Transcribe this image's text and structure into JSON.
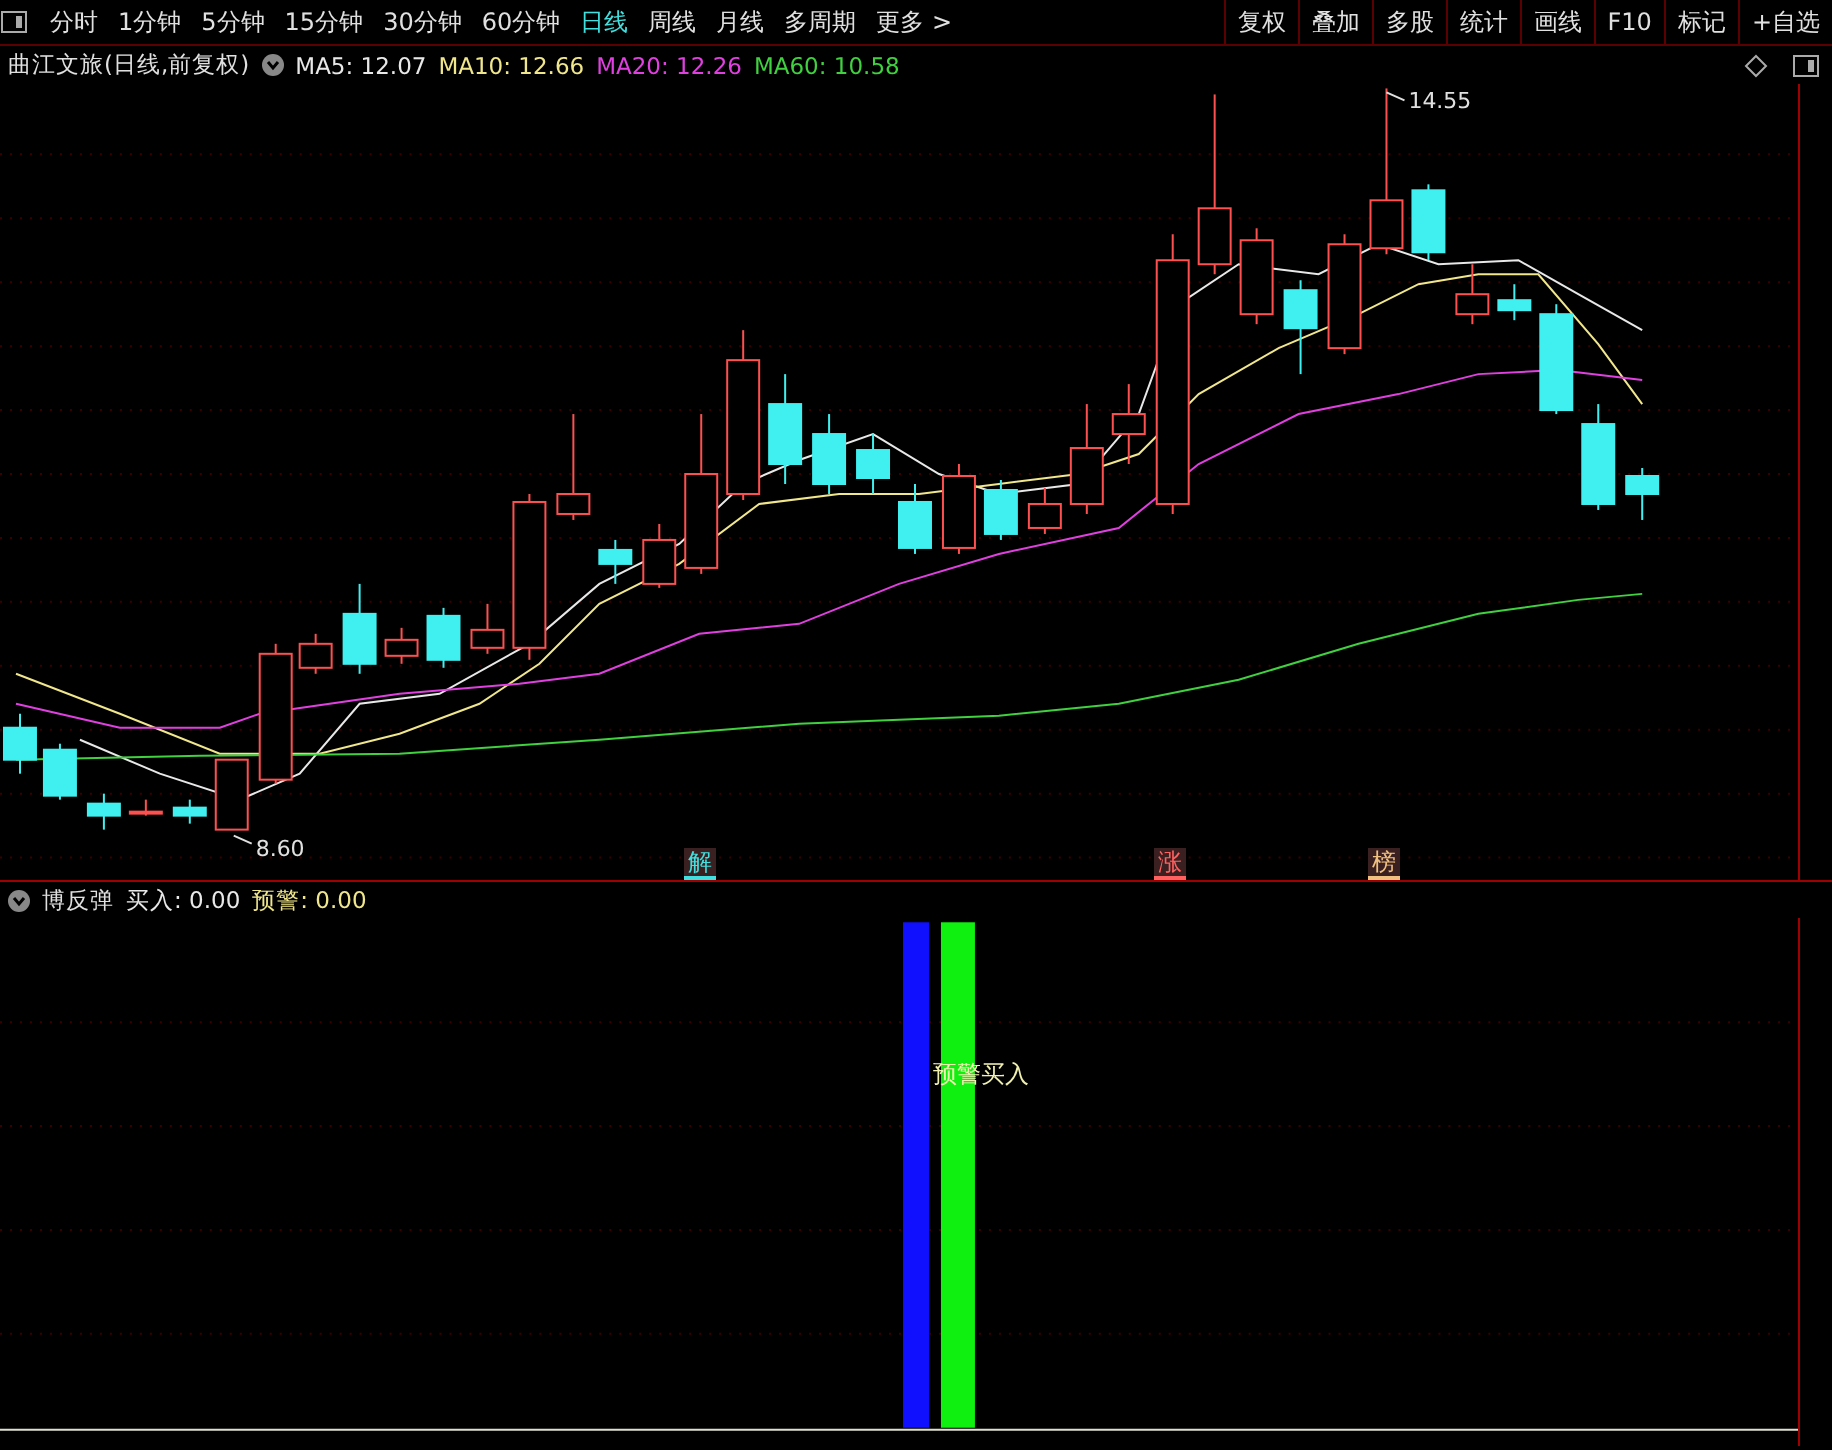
{
  "toolbar": {
    "periods": [
      {
        "label": "分时",
        "selected": false
      },
      {
        "label": "1分钟",
        "selected": false
      },
      {
        "label": "5分钟",
        "selected": false
      },
      {
        "label": "15分钟",
        "selected": false
      },
      {
        "label": "30分钟",
        "selected": false
      },
      {
        "label": "60分钟",
        "selected": false
      },
      {
        "label": "日线",
        "selected": true
      },
      {
        "label": "周线",
        "selected": false
      },
      {
        "label": "月线",
        "selected": false
      },
      {
        "label": "多周期",
        "selected": false
      }
    ],
    "more": "更多 >",
    "actions": [
      "复权",
      "叠加",
      "多股",
      "统计",
      "画线",
      "F10",
      "标记",
      "+自选"
    ]
  },
  "legend": {
    "title": "曲江文旅(日线,前复权)",
    "averages": [
      {
        "label": "MA5: 12.07",
        "color": "#e8e8e8"
      },
      {
        "label": "MA10: 12.66",
        "color": "#f0e68c"
      },
      {
        "label": "MA20: 12.26",
        "color": "#e040e0"
      },
      {
        "label": "MA60: 10.58",
        "color": "#40d040"
      }
    ]
  },
  "price_chart": {
    "high_label": "14.55",
    "low_label": "8.60",
    "event_tags": [
      {
        "text": "解",
        "color": "#40e0e0"
      },
      {
        "text": "涨",
        "color": "#ff6060"
      },
      {
        "text": "榜",
        "color": "#f0c080"
      }
    ]
  },
  "indicator": {
    "name": "博反弹",
    "values": [
      {
        "label": "买入: 0.00",
        "color": "#e8e8e8"
      },
      {
        "label": "预警: 0.00",
        "color": "#f0e68c"
      }
    ],
    "signal_label": "预警买入"
  }
}
